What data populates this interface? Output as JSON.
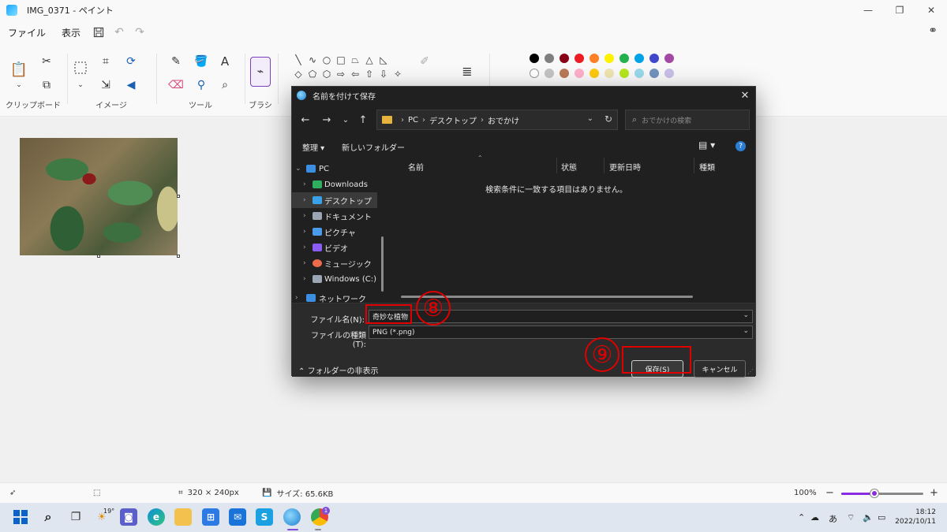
{
  "window": {
    "title": "IMG_0371 - ペイント",
    "minimize": "—",
    "maximize": "❐",
    "close": "✕"
  },
  "menu": {
    "file": "ファイル",
    "view": "表示"
  },
  "ribbon": {
    "groups": {
      "clipboard": "クリップボード",
      "image": "イメージ",
      "tools": "ツール",
      "brush": "ブラシ"
    },
    "palette": [
      "#000000",
      "#7f7f7f",
      "#880015",
      "#ed1c24",
      "#ff7f27",
      "#fff200",
      "#22b14c",
      "#00a2e8",
      "#3f48cc",
      "#a349a4",
      "#ffffff",
      "#c3c3c3",
      "#b97a57",
      "#ffaec9",
      "#ffc90e",
      "#efe4b0",
      "#b5e61d",
      "#99d9ea",
      "#7092be",
      "#c8bfe7"
    ],
    "current_color": "#000000"
  },
  "status": {
    "dimensions": "320 × 240px",
    "size": "サイズ: 65.6KB",
    "zoom": "100%",
    "zoom_level": 0.4
  },
  "dialog": {
    "title": "名前を付けて保存",
    "close": "✕",
    "breadcrumb": [
      "PC",
      "デスクトップ",
      "おでかけ"
    ],
    "search_placeholder": "おでかけの検索",
    "organize": "整理 ▾",
    "new_folder": "新しいフォルダー",
    "help": "?",
    "nav_items": [
      {
        "label": "PC",
        "color": "#3b8ee0"
      },
      {
        "label": "Downloads",
        "color": "#2fae5f"
      },
      {
        "label": "デスクトップ",
        "color": "#3aa0e8"
      },
      {
        "label": "ドキュメント",
        "color": "#9aa6b4"
      },
      {
        "label": "ピクチャ",
        "color": "#4a9be8"
      },
      {
        "label": "ビデオ",
        "color": "#8b5cf6"
      },
      {
        "label": "ミュージック",
        "color": "#ec6b4a"
      },
      {
        "label": "Windows (C:)",
        "color": "#9aa6b4"
      },
      {
        "label": "ネットワーク",
        "color": "#3b8ee0"
      }
    ],
    "columns": [
      "名前",
      "状態",
      "更新日時",
      "種類"
    ],
    "empty_message": "検索条件に一致する項目はありません。",
    "filename_label": "ファイル名(N):",
    "filename_value": "奇妙な植物",
    "filetype_label": "ファイルの種類(T):",
    "filetype_value": "PNG (*.png)",
    "hide_folders": "フォルダーの非表示",
    "save_button": "保存(S)",
    "cancel_button": "キャンセル"
  },
  "annotations": {
    "step8": "⑧",
    "step9": "⑨"
  },
  "taskbar": {
    "weather": "19°",
    "notification_badge": "1",
    "ime": "あ",
    "time": "18:12",
    "date": "2022/10/11"
  }
}
